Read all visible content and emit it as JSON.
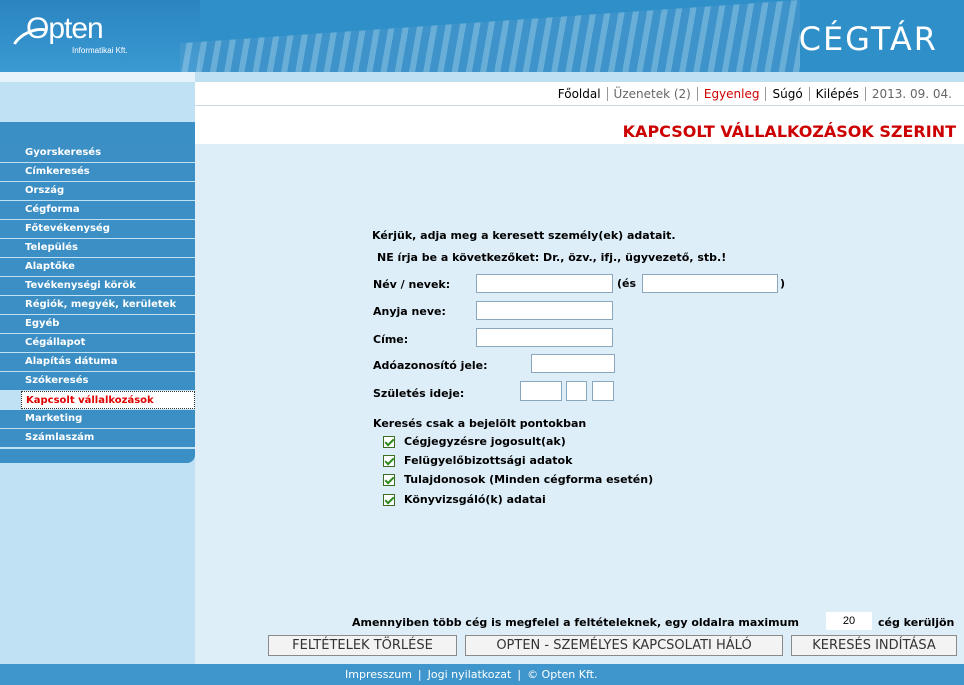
{
  "header": {
    "logo_name": "Opten",
    "logo_sub": "Informatikai Kft.",
    "brand": "CÉGTÁR"
  },
  "topnav": {
    "items": [
      "Főoldal",
      "Üzenetek (2)",
      "Egyenleg",
      "Súgó",
      "Kilépés",
      "2013. 09. 04."
    ]
  },
  "page_title": "KAPCSOLT VÁLLALKOZÁSOK SZERINT",
  "sidebar": {
    "items": [
      "Gyorskeresés",
      "Címkeresés",
      "Ország",
      "Cégforma",
      "Főtevékenység",
      "Település",
      "Alaptőke",
      "Tevékenységi körök",
      "Régiók, megyék, kerületek",
      "Egyéb",
      "Cégállapot",
      "Alapítás dátuma",
      "Szókeresés",
      "Kapcsolt vállalkozások",
      "Marketing",
      "Számlaszám"
    ],
    "active_index": 13
  },
  "form": {
    "intro": "Kérjük, adja meg a keresett személy(ek) adatait.",
    "warning": "NE írja be a következőket: Dr., özv., ifj., ügyvezető, stb.!",
    "name_label": "Név / nevek:",
    "and_open": "(és",
    "and_close": ")",
    "name_value": "",
    "name2_value": "",
    "mother_label": "Anyja neve:",
    "mother_value": "",
    "address_label": "Címe:",
    "address_value": "",
    "tax_label": "Adóazonosító jele:",
    "tax_value": "",
    "birth_label": "Születés ideje:",
    "birth_year": "",
    "birth_month": "",
    "birth_day": "",
    "filter_heading": "Keresés csak a bejelölt pontokban",
    "checkboxes": [
      {
        "label": "Cégjegyzésre jogosult(ak)",
        "checked": true
      },
      {
        "label": "Felügyelőbizottsági adatok",
        "checked": true
      },
      {
        "label": "Tulajdonosok (Minden cégforma esetén)",
        "checked": true
      },
      {
        "label": "Könyvizsgáló(k) adatai",
        "checked": true
      }
    ],
    "perpage_before": "Amennyiben több cég is megfelel a feltételeknek, egy oldalra maximum",
    "perpage_value": "20",
    "perpage_after": "cég kerüljön"
  },
  "buttons": {
    "clear": "FELTÉTELEK TÖRLÉSE",
    "network": "OPTEN - SZEMÉLYES KAPCSOLATI HÁLÓ",
    "search": "KERESÉS INDÍTÁSA"
  },
  "footer": {
    "links": [
      "Impresszum",
      "Jogi nyilatkozat",
      "© Opten Kft."
    ]
  },
  "colors": {
    "header_blue": "#2f8fc8",
    "menu_blue": "#3c8fc5",
    "main_bg": "#ddeef9",
    "title_red": "#cc0000"
  }
}
